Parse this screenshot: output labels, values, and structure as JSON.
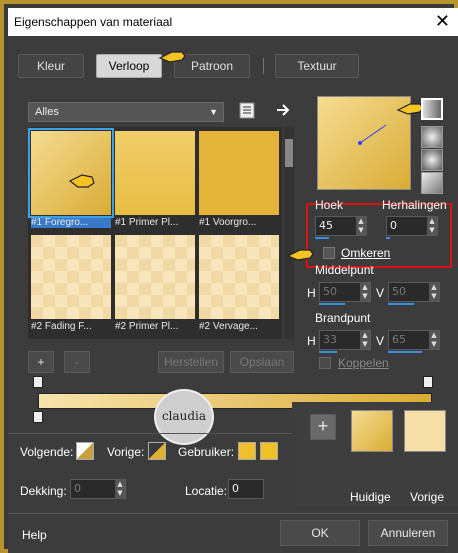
{
  "window": {
    "title": "Eigenschappen van materiaal",
    "close": "✕"
  },
  "tabs": [
    {
      "label": "Kleur"
    },
    {
      "label": "Verloop"
    },
    {
      "label": "Patroon"
    },
    {
      "label": "Textuur"
    }
  ],
  "library": {
    "category": "Alles",
    "items": [
      {
        "label": "#1 Foregro..."
      },
      {
        "label": "#1 Primer Pl..."
      },
      {
        "label": "#1 Voorgro..."
      },
      {
        "label": "#2 Fading F..."
      },
      {
        "label": "#2 Primer Pl..."
      },
      {
        "label": "#2 Vervage..."
      }
    ]
  },
  "buttons": {
    "add": "+",
    "remove": "-",
    "restore": "Herstellen",
    "save": "Opslaan",
    "ok": "OK",
    "cancel": "Annuleren",
    "help": "Help",
    "plus": "+"
  },
  "gradient": {
    "angle_label": "Hoek",
    "angle": "45",
    "repeats_label": "Herhalingen",
    "repeats": "0",
    "invert_label": "Omkeren",
    "center_label": "Middelpunt",
    "center_h_label": "H",
    "center_h": "50",
    "center_v_label": "V",
    "center_v": "50",
    "focal_label": "Brandpunt",
    "focal_h_label": "H",
    "focal_h": "33",
    "focal_v_label": "V",
    "focal_v": "65",
    "link_label": "Koppelen"
  },
  "stops": {
    "next_label": "Volgende:",
    "prev_label": "Vorige:",
    "user_label": "Gebruiker:",
    "opacity_label": "Dekking:",
    "opacity": "0",
    "location_label": "Locatie:",
    "location": "0"
  },
  "current": {
    "current_label": "Huidige",
    "previous_label": "Vorige"
  },
  "watermark": {
    "text": "claudia"
  },
  "colors": {
    "accent": "#3a8ee0",
    "highlight": "#d11111",
    "gold_light": "#f5dc92",
    "gold_dark": "#d9ac35"
  }
}
